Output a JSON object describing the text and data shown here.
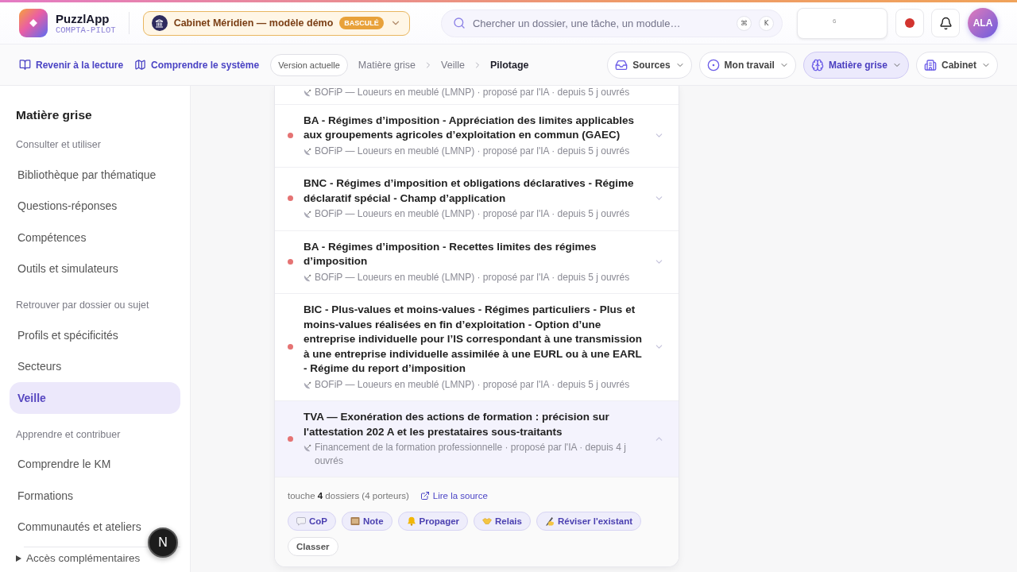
{
  "header": {
    "brand": {
      "name": "PuzzlApp",
      "tagline": "COMPTA-PILOT"
    },
    "workspace": {
      "name": "Cabinet Méridien — modèle démo",
      "badge": "BASCULÉ"
    },
    "search": {
      "placeholder": "Chercher un dossier, une tâche, un module…",
      "keys": [
        "⌘",
        "K"
      ]
    },
    "status_widget": {
      "count": "6"
    },
    "user": {
      "initials": "ALA"
    }
  },
  "subbar": {
    "links": [
      "Revenir à la lecture",
      "Comprendre le système"
    ],
    "version": "Version actuelle",
    "breadcrumb": [
      {
        "label": "Matière grise",
        "current": false
      },
      {
        "label": "Veille",
        "current": false
      },
      {
        "label": "Pilotage",
        "current": true
      }
    ],
    "menus": [
      {
        "label": "Sources",
        "selected": false
      },
      {
        "label": "Mon travail",
        "selected": false
      },
      {
        "label": "Matière grise",
        "selected": true
      },
      {
        "label": "Cabinet",
        "selected": false
      }
    ]
  },
  "sidebar": {
    "title": "Matière grise",
    "sections": [
      {
        "heading": "Consulter et utiliser",
        "items": [
          {
            "label": "Bibliothèque par thématique",
            "selected": false
          },
          {
            "label": "Questions-réponses",
            "selected": false
          },
          {
            "label": "Compétences",
            "selected": false
          },
          {
            "label": "Outils et simulateurs",
            "selected": false
          }
        ]
      },
      {
        "heading": "Retrouver par dossier ou sujet",
        "items": [
          {
            "label": "Profils et spécificités",
            "selected": false
          },
          {
            "label": "Secteurs",
            "selected": false
          },
          {
            "label": "Veille",
            "selected": true
          }
        ]
      },
      {
        "heading": "Apprendre et contribuer",
        "items": [
          {
            "label": "Comprendre le KM",
            "selected": false
          },
          {
            "label": "Formations",
            "selected": false
          },
          {
            "label": "Communautés et ateliers",
            "selected": false
          }
        ]
      }
    ],
    "more": {
      "label": "Accès complémentaires",
      "expanded": false
    }
  },
  "feed": {
    "clipped_meta": "BOFiP — Loueurs en meublé (LMNP) · proposé par l'IA · depuis 5 j ouvrés",
    "items": [
      {
        "title": "BA - Régimes d’imposition - Appréciation des limites applicables aux groupements agricoles d’exploitation en commun (GAEC)",
        "meta": "BOFiP — Loueurs en meublé (LMNP) · proposé par l'IA · depuis 5 j ouvrés",
        "unread": true,
        "expanded": false
      },
      {
        "title": "BNC - Régimes d’imposition et obligations déclaratives - Régime déclaratif spécial - Champ d’application",
        "meta": "BOFiP — Loueurs en meublé (LMNP) · proposé par l'IA · depuis 5 j ouvrés",
        "unread": true,
        "expanded": false
      },
      {
        "title": "BA - Régimes d’imposition - Recettes limites des régimes d’imposition",
        "meta": "BOFiP — Loueurs en meublé (LMNP) · proposé par l'IA · depuis 5 j ouvrés",
        "unread": true,
        "expanded": false
      },
      {
        "title": "BIC - Plus-values et moins-values - Régimes particuliers - Plus et moins-values réalisées en fin d’exploitation - Option d’une entreprise individuelle pour l’IS correspondant à une transmission à une entreprise individuelle assimilée à une EURL ou à une EARL - Régime du report d’imposition",
        "meta": "BOFiP — Loueurs en meublé (LMNP) · proposé par l'IA · depuis 5 j ouvrés",
        "unread": true,
        "expanded": false
      },
      {
        "title": "TVA — Exonération des actions de formation : précision sur l'attestation 202 A et les prestataires sous-traitants",
        "meta": "Financement de la formation professionnelle · proposé par l'IA · depuis 4 j ouvrés",
        "unread": true,
        "expanded": true,
        "details": {
          "impact": "touche **4** dossiers (4 porteurs)",
          "source_link": "Lire la source",
          "actions": [
            {
              "label": "CoP",
              "kind": "tag"
            },
            {
              "label": "Note",
              "kind": "tag"
            },
            {
              "label": "Propager",
              "kind": "tag"
            },
            {
              "label": "Relais",
              "kind": "tag"
            },
            {
              "label": "Réviser l'existant",
              "kind": "tag"
            },
            {
              "label": "Classer",
              "kind": "plain"
            }
          ]
        }
      }
    ]
  },
  "dev_badge": {
    "label": "N"
  }
}
